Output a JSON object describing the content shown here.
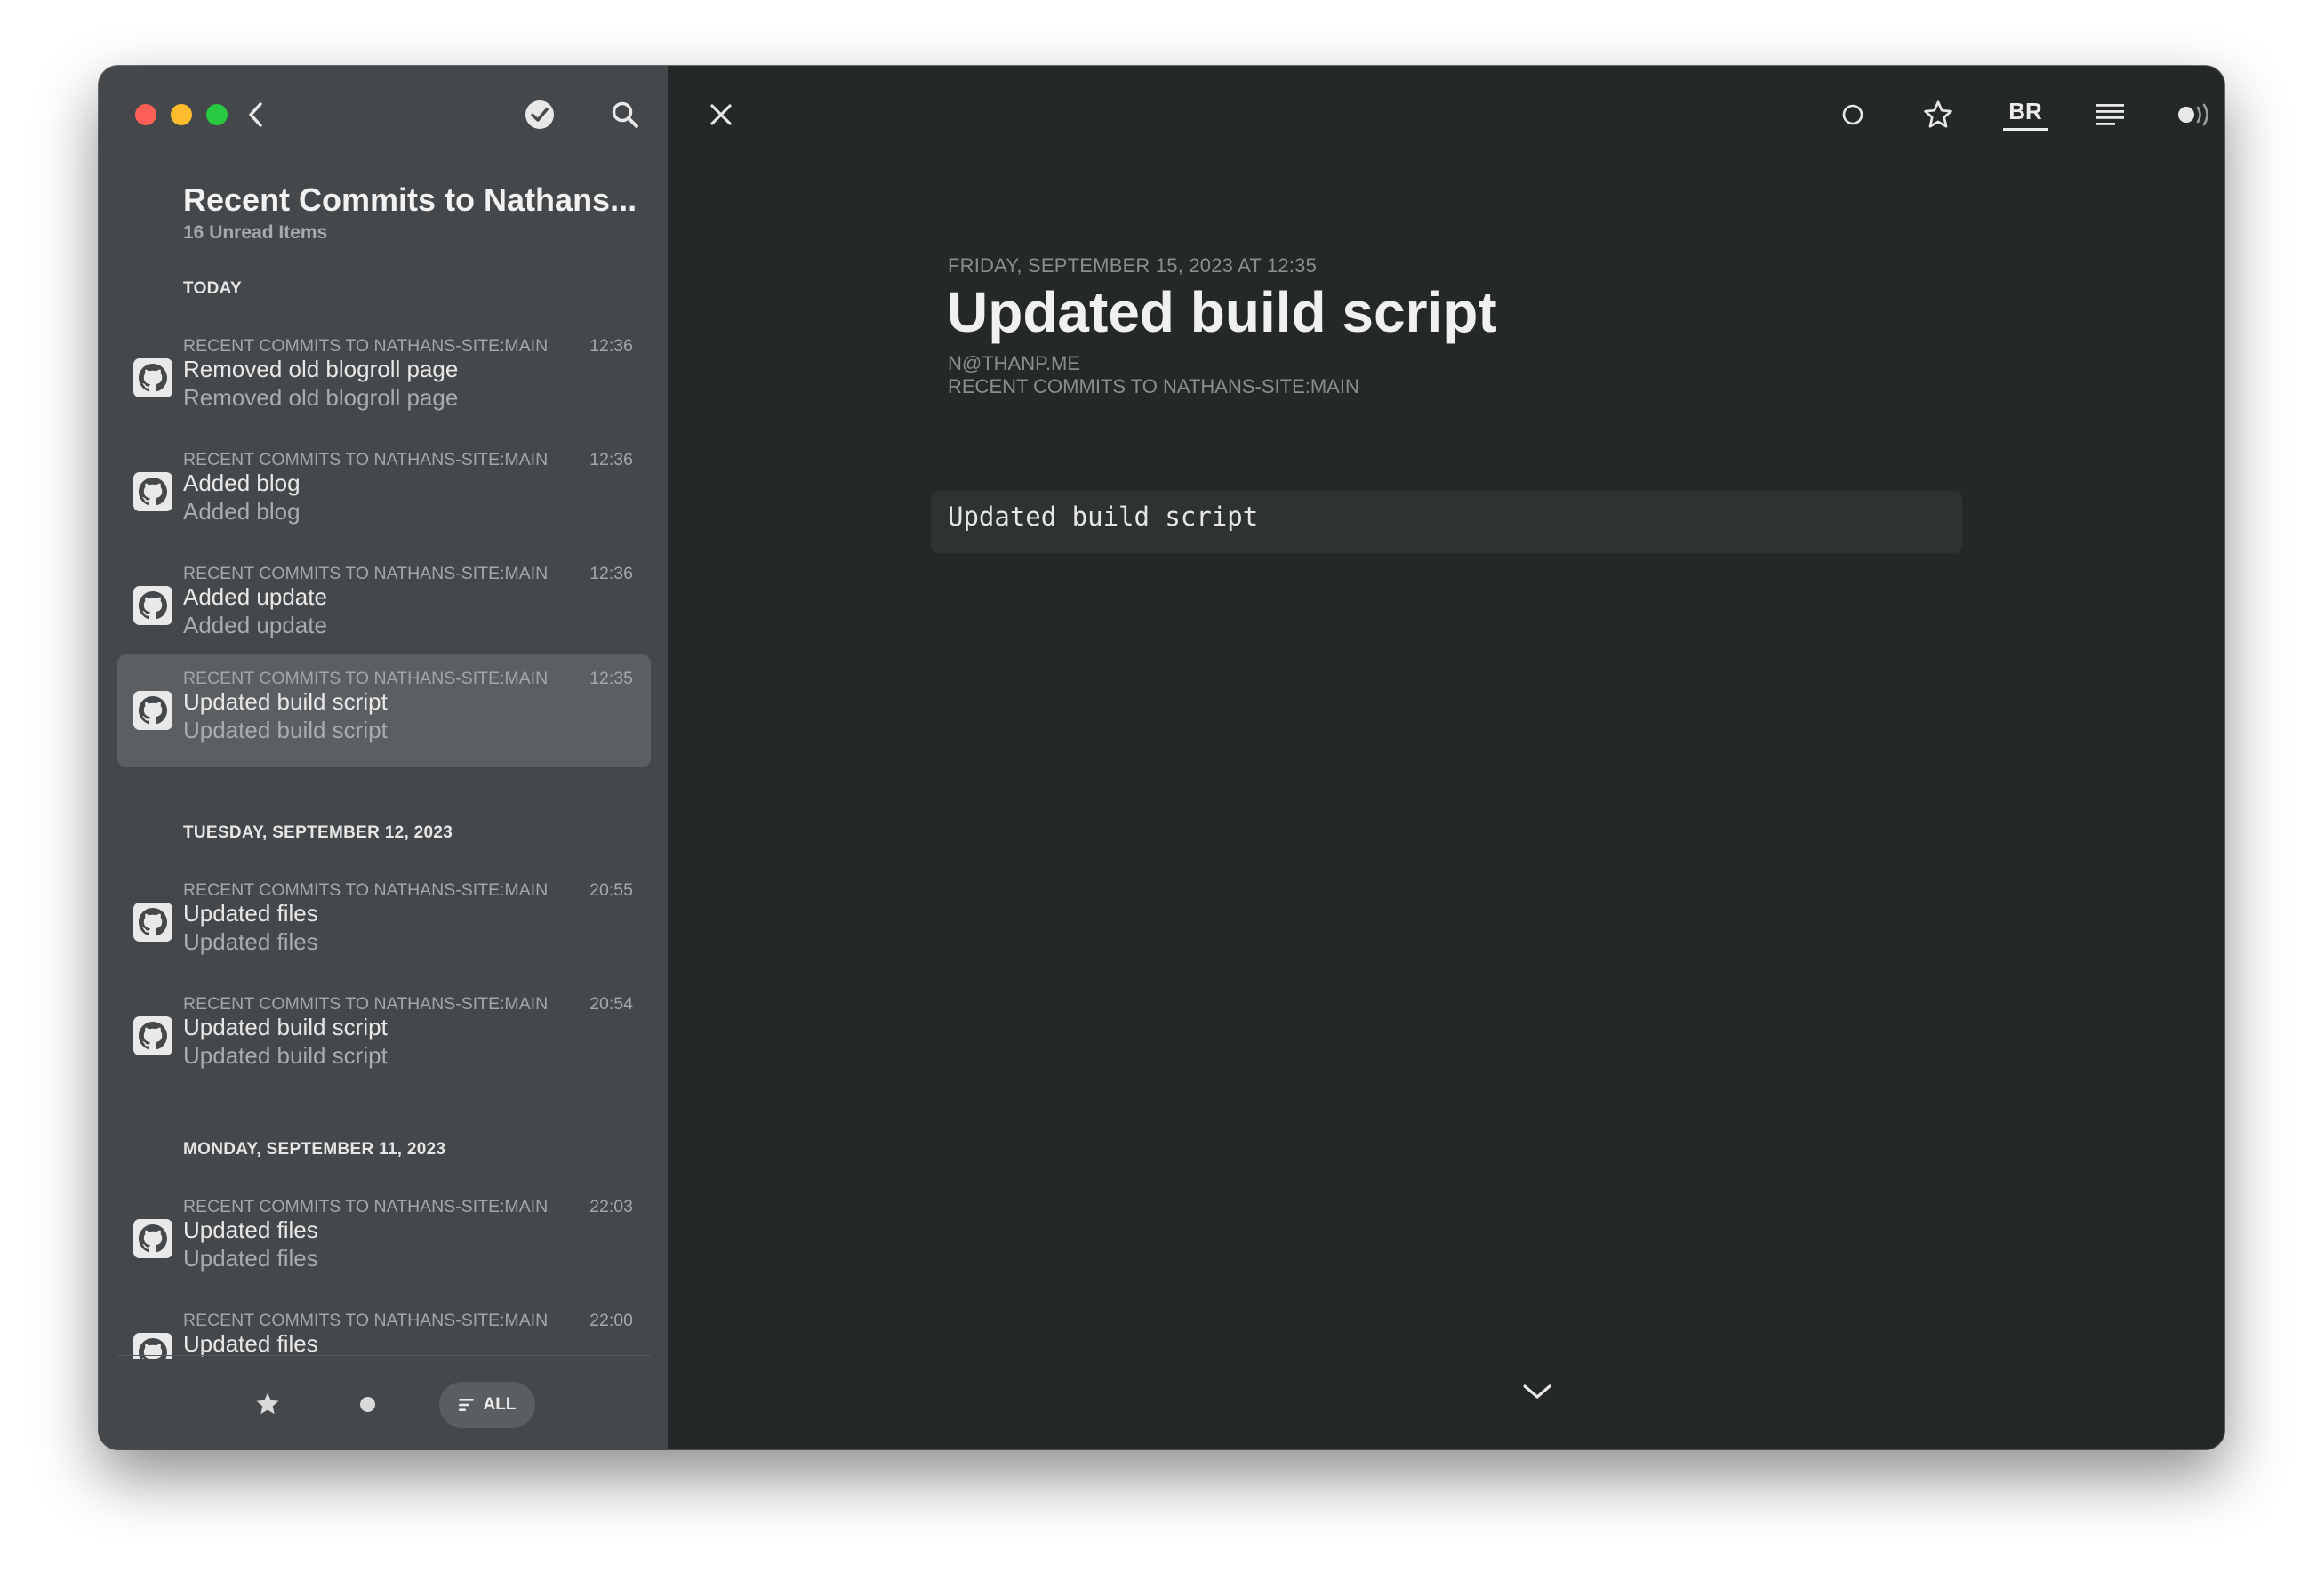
{
  "sidebar": {
    "feed_title": "Recent Commits to Nathans...",
    "unread_label": "16 Unread Items",
    "sections": [
      {
        "header": "TODAY",
        "items": [
          {
            "source": "RECENT COMMITS TO NATHANS-SITE:MAIN",
            "time": "12:36",
            "title": "Removed old blogroll page",
            "summary": "Removed old blogroll page",
            "selected": false
          },
          {
            "source": "RECENT COMMITS TO NATHANS-SITE:MAIN",
            "time": "12:36",
            "title": "Added blog",
            "summary": "Added blog",
            "selected": false
          },
          {
            "source": "RECENT COMMITS TO NATHANS-SITE:MAIN",
            "time": "12:36",
            "title": "Added update",
            "summary": "Added update",
            "selected": false
          },
          {
            "source": "RECENT COMMITS TO NATHANS-SITE:MAIN",
            "time": "12:35",
            "title": "Updated build script",
            "summary": "Updated build script",
            "selected": true
          }
        ]
      },
      {
        "header": "TUESDAY, SEPTEMBER 12, 2023",
        "items": [
          {
            "source": "RECENT COMMITS TO NATHANS-SITE:MAIN",
            "time": "20:55",
            "title": "Updated files",
            "summary": "Updated files",
            "selected": false
          },
          {
            "source": "RECENT COMMITS TO NATHANS-SITE:MAIN",
            "time": "20:54",
            "title": "Updated build script",
            "summary": "Updated build script",
            "selected": false
          }
        ]
      },
      {
        "header": "MONDAY, SEPTEMBER 11, 2023",
        "items": [
          {
            "source": "RECENT COMMITS TO NATHANS-SITE:MAIN",
            "time": "22:03",
            "title": "Updated files",
            "summary": "Updated files",
            "selected": false
          },
          {
            "source": "RECENT COMMITS TO NATHANS-SITE:MAIN",
            "time": "22:00",
            "title": "Updated files",
            "summary": "",
            "selected": false
          }
        ]
      }
    ],
    "filter_all_label": "ALL"
  },
  "toolbar": {
    "reader_mode_label": "BR"
  },
  "article": {
    "date": "FRIDAY, SEPTEMBER 15, 2023 AT 12:35",
    "title": "Updated build script",
    "author": "N@THANP.ME",
    "feed": "RECENT COMMITS TO NATHANS-SITE:MAIN",
    "code": "Updated build script"
  },
  "colors": {
    "sidebar_bg": "#45484a",
    "reader_bg": "#242829",
    "selected_row": "#5c5f61",
    "traffic_close": "#fe5f57",
    "traffic_min": "#febc2e",
    "traffic_max": "#28c840"
  }
}
